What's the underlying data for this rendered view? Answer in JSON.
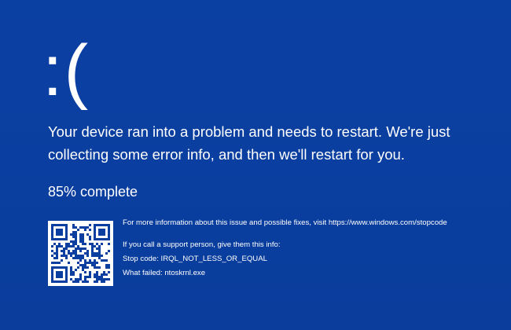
{
  "screen": {
    "background_color": "#0a3fa0",
    "text_color": "#ffffff"
  },
  "face": {
    "emoticon": ":("
  },
  "message": {
    "text": "Your device ran into a problem and needs to restart. We're just collecting some error info, and then we'll restart for you."
  },
  "progress": {
    "percent": 85,
    "text": "85% complete"
  },
  "qr_code": {
    "icon": "qr-code-icon"
  },
  "info": {
    "more_info": "For more information about this issue and possible fixes, visit https://www.windows.com/stopcode",
    "support_prompt": "If you call a support person, give them this info:",
    "stop_code": "Stop code: IRQL_NOT_LESS_OR_EQUAL",
    "what_failed": "What failed: ntoskrnl.exe"
  }
}
